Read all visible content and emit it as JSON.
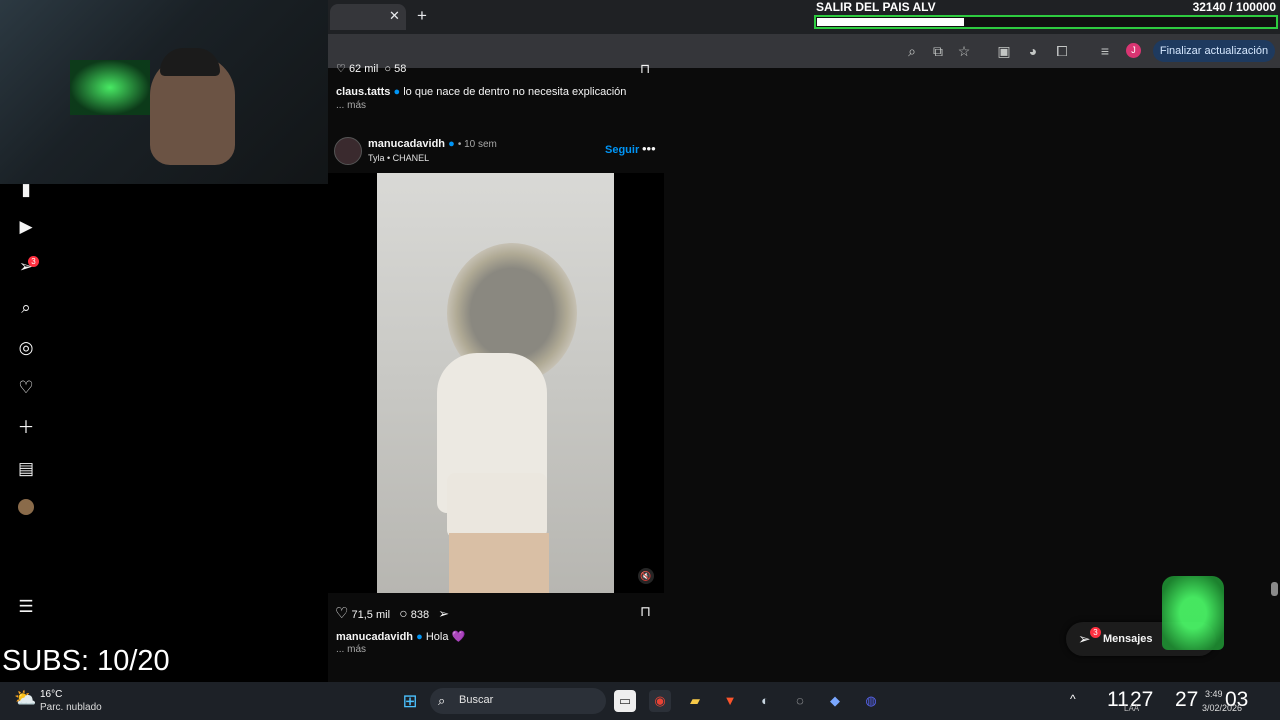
{
  "goal": {
    "title": "SALIR DEL PAIS ALV",
    "count": "32140 / 100000",
    "progress": 0.3214
  },
  "browser": {
    "update_label": "Finalizar actualización",
    "profile_initial": "J"
  },
  "nav": {
    "messages_badge": "3"
  },
  "prev_post": {
    "likes": "62 mil",
    "comments": "58",
    "author": "claus.tatts",
    "caption": "lo que nace de dentro no necesita explicación",
    "more": "... más"
  },
  "post": {
    "author": "manucadavidh",
    "time": "• 10 sem",
    "music": "Tyla • CHANEL",
    "follow": "Seguir",
    "likes": "71,5 mil",
    "comments": "838",
    "caption": "Hola 💜",
    "more": "... más"
  },
  "messages": {
    "label": "Mensajes",
    "badge": "3"
  },
  "overlay": {
    "subs": "SUBS: 10/20"
  },
  "taskbar": {
    "temp": "16°C",
    "weather": "Parc. nublado",
    "search_placeholder": "Buscar",
    "timer_hours": "11",
    "timer_minutes": "27",
    "timer_seconds": "27",
    "timer_extra": "03",
    "time": "3:49",
    "date": "3/02/2026",
    "lang": "LAA"
  },
  "colors": {
    "accent": "#0095f6",
    "goal_border": "#2ecc40",
    "badge": "#ff3040"
  }
}
